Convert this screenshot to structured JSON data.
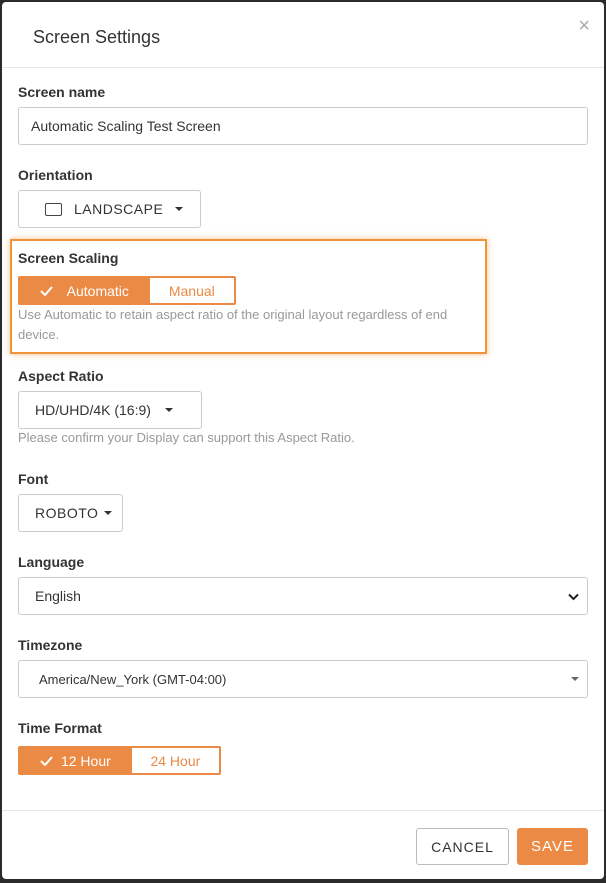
{
  "modal": {
    "title": "Screen Settings",
    "close_icon": "×"
  },
  "screen_name": {
    "label": "Screen name",
    "value": "Automatic Scaling Test Screen"
  },
  "orientation": {
    "label": "Orientation",
    "value": "LANDSCAPE",
    "icon": "monitor-icon"
  },
  "screen_scaling": {
    "label": "Screen Scaling",
    "options": [
      "Automatic",
      "Manual"
    ],
    "selected": "Automatic",
    "helper": "Use Automatic to retain aspect ratio of the original layout regardless of end device."
  },
  "aspect_ratio": {
    "label": "Aspect Ratio",
    "value": "HD/UHD/4K (16:9)",
    "helper": "Please confirm your Display can support this Aspect Ratio."
  },
  "font": {
    "label": "Font",
    "value": "ROBOTO"
  },
  "language": {
    "label": "Language",
    "value": "English"
  },
  "timezone": {
    "label": "Timezone",
    "value": "America/New_York (GMT-04:00)"
  },
  "time_format": {
    "label": "Time Format",
    "options": [
      "12 Hour",
      "24 Hour"
    ],
    "selected": "12 Hour"
  },
  "footer": {
    "cancel_label": "CANCEL",
    "save_label": "SAVE"
  },
  "colors": {
    "accent": "#ea8a45",
    "highlight": "#f0943b"
  }
}
